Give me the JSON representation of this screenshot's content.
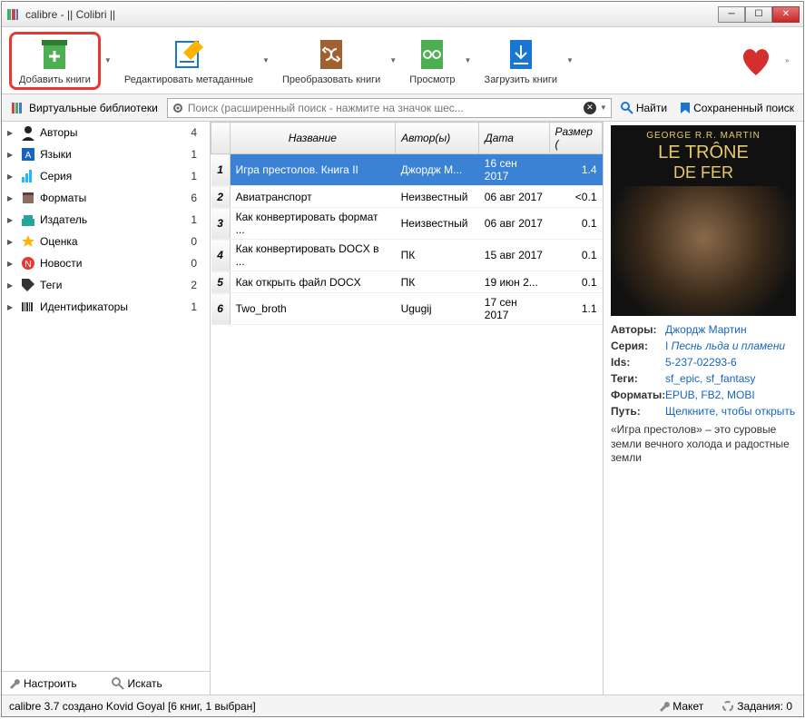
{
  "window": {
    "title": "calibre - || Colibri ||"
  },
  "toolbar": {
    "add": "Добавить книги",
    "edit": "Редактировать метаданные",
    "convert": "Преобразовать книги",
    "view": "Просмотр",
    "download": "Загрузить книги"
  },
  "searchbar": {
    "vlib": "Виртуальные библиотеки",
    "placeholder": "Поиск (расширенный поиск - нажмите на значок шес...",
    "find": "Найти",
    "saved": "Сохраненный поиск"
  },
  "sidebar": {
    "items": [
      {
        "label": "Авторы",
        "count": 4,
        "icon": "person"
      },
      {
        "label": "Языки",
        "count": 1,
        "icon": "lang"
      },
      {
        "label": "Серия",
        "count": 1,
        "icon": "series"
      },
      {
        "label": "Форматы",
        "count": 6,
        "icon": "book"
      },
      {
        "label": "Издатель",
        "count": 1,
        "icon": "publisher"
      },
      {
        "label": "Оценка",
        "count": 0,
        "icon": "star"
      },
      {
        "label": "Новости",
        "count": 0,
        "icon": "news"
      },
      {
        "label": "Теги",
        "count": 2,
        "icon": "tag"
      },
      {
        "label": "Идентификаторы",
        "count": 1,
        "icon": "barcode"
      }
    ],
    "configure": "Настроить",
    "search": "Искать"
  },
  "table": {
    "headers": {
      "title": "Название",
      "author": "Автор(ы)",
      "date": "Дата",
      "size": "Размер ("
    },
    "rows": [
      {
        "n": 1,
        "title": "Игра престолов. Книга II",
        "author": "Джордж М...",
        "date": "16 сен 2017",
        "size": "1.4",
        "selected": true
      },
      {
        "n": 2,
        "title": "Авиатранспорт",
        "author": "Неизвестный",
        "date": "06 авг 2017",
        "size": "<0.1"
      },
      {
        "n": 3,
        "title": "Как конвертировать формат ...",
        "author": "Неизвестный",
        "date": "06 авг 2017",
        "size": "0.1"
      },
      {
        "n": 4,
        "title": "Как конвертировать DOCX в ...",
        "author": "ПК",
        "date": "15 авг 2017",
        "size": "0.1"
      },
      {
        "n": 5,
        "title": "Как открыть файл DOCX",
        "author": "ПК",
        "date": "19 июн 2...",
        "size": "0.1"
      },
      {
        "n": 6,
        "title": "Two_broth",
        "author": "Ugugij",
        "date": "17 сен 2017",
        "size": "1.1"
      }
    ]
  },
  "details": {
    "cover": {
      "author": "GEORGE R.R. MARTIN",
      "title1": "LE TRÔNE",
      "title2": "DE FER"
    },
    "authors_label": "Авторы:",
    "authors": "Джордж Мартин",
    "series_label": "Серия:",
    "series_prefix": "I ",
    "series": "Песнь льда и пламени",
    "ids_label": "Ids:",
    "ids": "5-237-02293-6",
    "tags_label": "Теги:",
    "tags": "sf_epic, sf_fantasy",
    "formats_label": "Форматы:",
    "formats": "EPUB, FB2, MOBI",
    "path_label": "Путь:",
    "path": "Щелкните, чтобы открыть",
    "desc": "«Игра престолов» – это суровые земли вечного холода и радостные земли"
  },
  "status": {
    "left": "calibre 3.7 создано Kovid Goyal   [6 книг, 1 выбран]",
    "layout": "Макет",
    "jobs": "Задания: 0"
  }
}
